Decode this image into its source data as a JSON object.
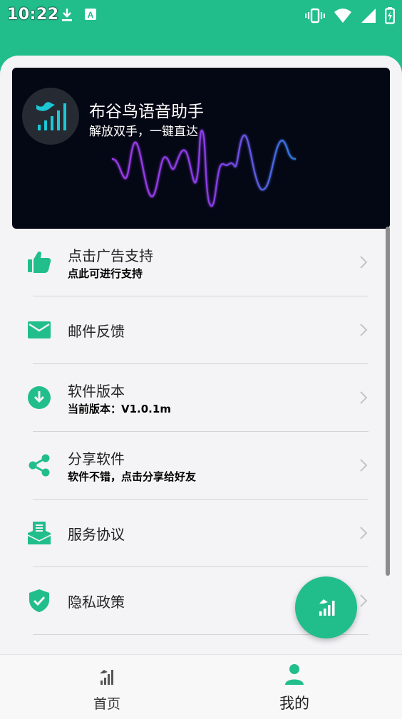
{
  "status_bar": {
    "time": "10:22",
    "icons": [
      "download-icon",
      "keyboard-a-icon",
      "vibrate-icon",
      "wifi-icon",
      "signal-icon",
      "battery-charging-icon"
    ]
  },
  "colors": {
    "primary": "#21BE8B",
    "background": "#F4F3F6",
    "banner_bg": "#040714",
    "wave_purple": "#9B3BE8",
    "wave_blue": "#2E7BE0",
    "wave_cyan": "#19C7E8"
  },
  "banner": {
    "app_name": "布谷鸟语音助手",
    "slogan": "解放双手，一键直达",
    "logo_icon": "bird-signal-icon"
  },
  "menu": [
    {
      "icon": "thumbs-up-icon",
      "title": "点击广告支持",
      "subtitle": "点此可进行支持"
    },
    {
      "icon": "mail-icon",
      "title": "邮件反馈",
      "subtitle": ""
    },
    {
      "icon": "download-circle-icon",
      "title": "软件版本",
      "subtitle": "当前版本：V1.0.1m"
    },
    {
      "icon": "share-icon",
      "title": "分享软件",
      "subtitle": "软件不错，点击分享给好友"
    },
    {
      "icon": "agreement-icon",
      "title": "服务协议",
      "subtitle": ""
    },
    {
      "icon": "shield-check-icon",
      "title": "隐私政策",
      "subtitle": ""
    }
  ],
  "fab": {
    "icon": "signal-bars-icon"
  },
  "bottom_nav": {
    "tabs": [
      {
        "label": "首页",
        "icon": "signal-bars-icon",
        "active": false
      },
      {
        "label": "我的",
        "icon": "person-icon",
        "active": true
      }
    ]
  }
}
